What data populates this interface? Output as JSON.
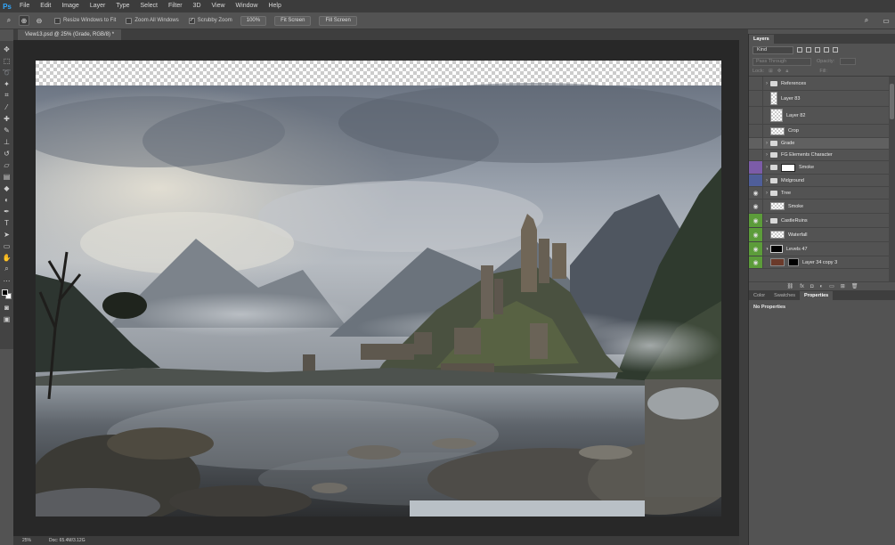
{
  "app": {
    "logo": "Ps"
  },
  "menu": [
    "File",
    "Edit",
    "Image",
    "Layer",
    "Type",
    "Select",
    "Filter",
    "3D",
    "View",
    "Window",
    "Help"
  ],
  "options": {
    "resize_windows": "Resize Windows to Fit",
    "zoom_all_windows": "Zoom All Windows",
    "scrubby_zoom": "Scrubby Zoom",
    "zoom_value": "100%",
    "fit_screen": "Fit Screen",
    "fill_screen": "Fill Screen"
  },
  "document": {
    "tab_title": "View13.psd @ 25% (Grade, RGB/8) *"
  },
  "status": {
    "zoom": "25%",
    "doc": "Doc: 65.4M/3.12G"
  },
  "layers_panel": {
    "tab": "Layers",
    "filter_kind": "Kind",
    "blend_mode": "Pass Through",
    "opacity_label": "Opacity:",
    "lock_label": "Lock:",
    "fill_label": "Fill:",
    "layers": [
      {
        "name": "References",
        "type": "group",
        "visible": false,
        "color": ""
      },
      {
        "name": "Layer 83",
        "type": "layer",
        "visible": false,
        "color": ""
      },
      {
        "name": "Layer 82",
        "type": "layer",
        "visible": false,
        "color": ""
      },
      {
        "name": "Crop",
        "type": "layer",
        "visible": false,
        "color": ""
      },
      {
        "name": "Grade",
        "type": "group",
        "visible": false,
        "color": "",
        "selected": true
      },
      {
        "name": "FG Elements Character",
        "type": "group",
        "visible": false,
        "color": ""
      },
      {
        "name": "Smoke",
        "type": "group",
        "visible": false,
        "color": "purple"
      },
      {
        "name": "Midground",
        "type": "group",
        "visible": false,
        "color": "blue"
      },
      {
        "name": "Tree",
        "type": "group",
        "visible": true,
        "color": ""
      },
      {
        "name": "Smoke",
        "type": "layer",
        "visible": true,
        "color": ""
      },
      {
        "name": "CastleRuins",
        "type": "group",
        "visible": true,
        "color": "green"
      },
      {
        "name": "Waterfall",
        "type": "layer",
        "visible": true,
        "color": "green"
      },
      {
        "name": "Levels 47",
        "type": "adjust",
        "visible": true,
        "color": "green"
      },
      {
        "name": "Layer 34 copy 3",
        "type": "layer",
        "visible": true,
        "color": "green"
      }
    ]
  },
  "bottom_panel": {
    "tabs": [
      "Color",
      "Swatches",
      "Properties"
    ],
    "active_tab": "Properties",
    "body": "No Properties"
  }
}
